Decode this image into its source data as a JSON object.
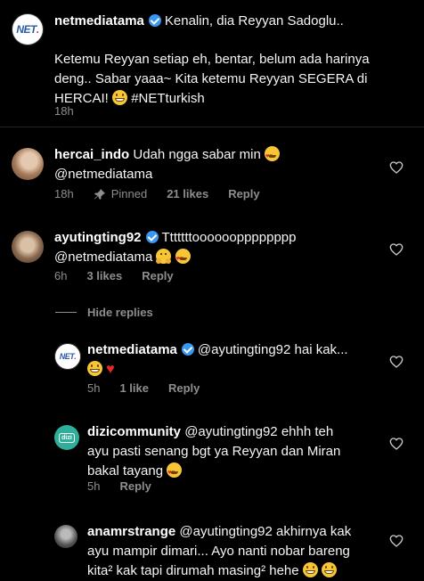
{
  "post": {
    "username": "netmediatama",
    "caption_line1": "Kenalin, dia Reyyan Sadoglu..",
    "caption_body": "Ketemu Reyyan setiap eh, bentar, belum ada harinya deng.. Sabar yaaa~ Kita ketemu Reyyan SEGERA di HERCAI!",
    "hashtag": "#NETturkish",
    "time": "18h"
  },
  "comments": [
    {
      "username": "hercai_indo",
      "text": "Udah ngga sabar min",
      "mention": "@netmediatama",
      "time": "18h",
      "pinned": "Pinned",
      "likes": "21 likes",
      "reply": "Reply"
    },
    {
      "username": "ayutingting92",
      "text": "Tttttttoooooopppppppp",
      "mention": "@netmediatama",
      "time": "6h",
      "likes": "3 likes",
      "reply": "Reply"
    }
  ],
  "hide_replies": "Hide replies",
  "replies": [
    {
      "username": "netmediatama",
      "mention": "@ayutingting92",
      "text": "hai kak...",
      "time": "5h",
      "likes": "1 like",
      "reply": "Reply"
    },
    {
      "username": "dizicommunity",
      "mention": "@ayutingting92",
      "text_line1": "ehhh teh",
      "text_line2": "ayu pasti senang bgt ya Reyyan dan Miran",
      "text_line3": "bakal tayang",
      "time": "5h",
      "reply": "Reply"
    },
    {
      "username": "anamrstrange",
      "mention": "@ayutingting92",
      "text_line1": "akhirnya kak",
      "text_line2": "ayu mampir dimari... Ayo nanti nobar bareng",
      "text_line3": "kita² kak tapi dirumah masing² hehe"
    }
  ],
  "icons": {
    "verified": "verified-badge-icon",
    "heart": "heart-outline-icon",
    "pin": "pin-icon"
  },
  "colors": {
    "background": "#000000",
    "secondary_text": "#8e8e8e",
    "verified_blue": "#3897f0"
  }
}
